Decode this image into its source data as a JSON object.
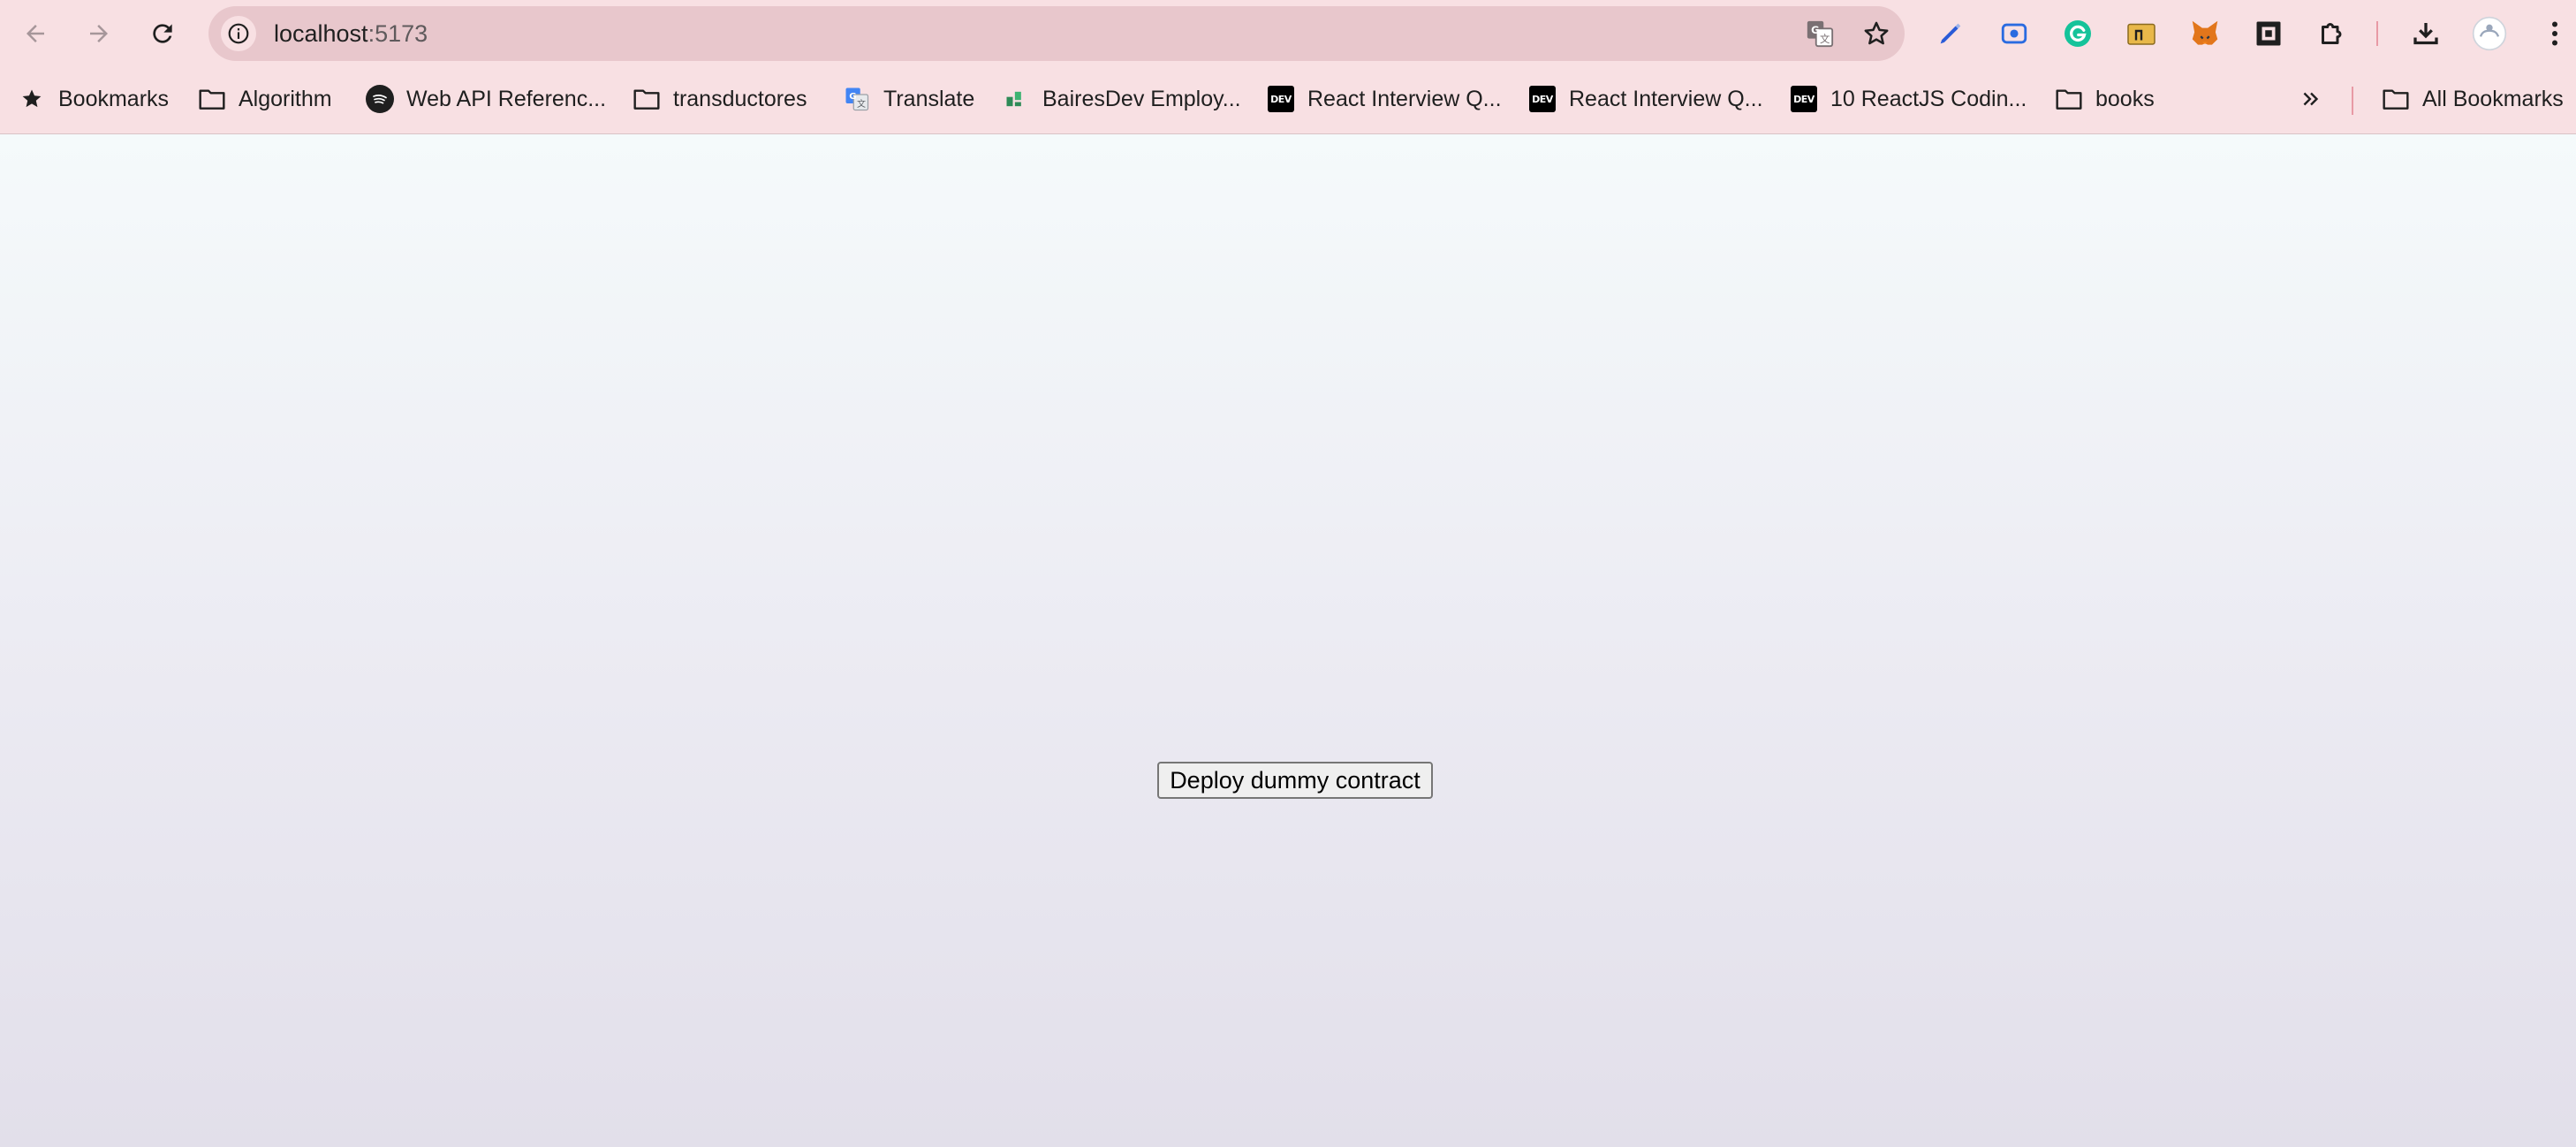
{
  "window": {
    "url_host": "localhost",
    "url_port": ":5173"
  },
  "toolbar": {
    "nav_icons": [
      "back-arrow-icon",
      "forward-arrow-icon",
      "reload-icon"
    ],
    "omnibox_icons": [
      "site-info-icon",
      "google-translate-icon",
      "bookmark-star-icon"
    ],
    "extension_icons": [
      "pen-extension-icon",
      "screen-record-extension-icon",
      "grammarly-icon",
      "extension-folder-icon",
      "metamask-fox-icon",
      "square-extension-icon",
      "extensions-puzzle-icon",
      "downloads-icon",
      "profile-avatar-icon",
      "menu-kebab-icon"
    ]
  },
  "bookmarks": {
    "items": [
      {
        "label": "Bookmarks",
        "icon": "star-icon"
      },
      {
        "label": "Algorithm",
        "icon": "folder-icon"
      },
      {
        "label": "Web API Referenc...",
        "icon": "spotify-icon"
      },
      {
        "label": "transductores",
        "icon": "folder-icon"
      },
      {
        "label": "Translate",
        "icon": "google-translate-icon"
      },
      {
        "label": "BairesDev Employ...",
        "icon": "bairesdev-icon"
      },
      {
        "label": "React Interview Q...",
        "icon": "dev-icon"
      },
      {
        "label": "React Interview Q...",
        "icon": "dev-icon"
      },
      {
        "label": "10 ReactJS Codin...",
        "icon": "dev-icon"
      },
      {
        "label": "books",
        "icon": "folder-icon"
      }
    ],
    "overflow_icon": "chevron-double-right-icon",
    "all_bookmarks": {
      "label": "All Bookmarks",
      "icon": "folder-icon"
    },
    "dev_badge_text": "DEV"
  },
  "page": {
    "deploy_button_label": "Deploy dummy contract"
  },
  "colors": {
    "chrome_bg": "#f8e0e3",
    "omnibox_bg": "#e8c7cc",
    "separator": "#e89aa5",
    "page_top": "#f5fafb",
    "page_bottom": "#e2dfea",
    "metamask_orange": "#e2761b",
    "grammarly_green": "#15c39a"
  }
}
